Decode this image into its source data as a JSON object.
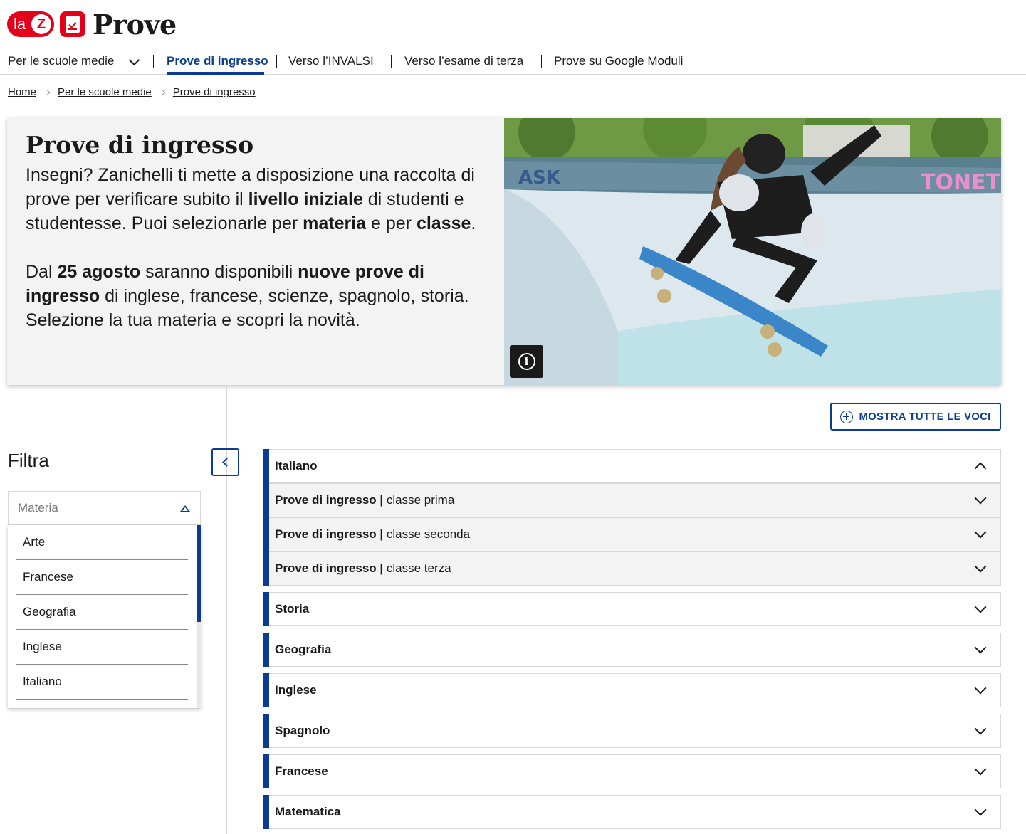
{
  "header": {
    "logo_la": "la",
    "logo_z": "Z",
    "title": "Prove"
  },
  "nav": {
    "items": [
      {
        "label": "Per le scuole medie"
      },
      {
        "label": "Prove di ingresso"
      },
      {
        "label": "Verso l’INVALSI"
      },
      {
        "label": "Verso l’esame di terza"
      },
      {
        "label": "Prove su Google Moduli"
      }
    ]
  },
  "breadcrumb": [
    "Home",
    "Per le scuole medie",
    "Prove di ingresso"
  ],
  "hero": {
    "title": "Prove di ingresso",
    "p1": {
      "a": "Insegni? Zanichelli ti mette a disposizione una raccolta di prove per verificare subito il ",
      "b1": "livello iniziale",
      "c": " di studenti e studentesse. Puoi selezionarle per ",
      "b2": "materia",
      "d": " e per ",
      "b3": "classe",
      "e": "."
    },
    "p2": {
      "a": "Dal ",
      "b1": "25 agosto",
      "c": " saranno disponibili ",
      "b2": "nuove prove di ingresso",
      "d": " di inglese, francese, scienze, spagnolo, storia. Selezione la tua materia e scopri la novità."
    },
    "image_graffiti": "TONET"
  },
  "actions": {
    "show_all": "MOSTRA TUTTE LE VOCI"
  },
  "filter": {
    "title": "Filtra",
    "select_placeholder": "Materia",
    "options": [
      "Arte",
      "Francese",
      "Geografia",
      "Inglese",
      "Italiano"
    ]
  },
  "accordion": {
    "italiano": "Italiano",
    "sub_bold": "Prove di ingresso",
    "sub_sep": " | ",
    "sub": [
      "classe prima",
      "classe seconda",
      "classe terza"
    ],
    "others": [
      "Storia",
      "Geografia",
      "Inglese",
      "Spagnolo",
      "Francese",
      "Matematica"
    ]
  },
  "colors": {
    "brand_red": "#e2001a",
    "accent_blue": "#0a3d91"
  }
}
